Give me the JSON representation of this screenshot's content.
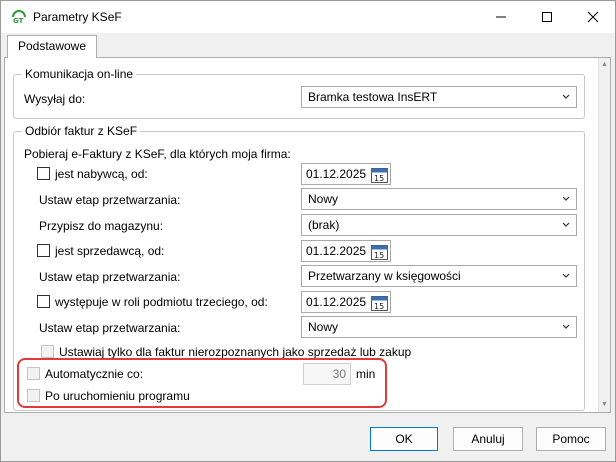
{
  "window": {
    "title": "Parametry KSeF"
  },
  "tabs": [
    {
      "label": "Podstawowe"
    }
  ],
  "communication": {
    "legend": "Komunikacja on-line",
    "send_to_label": "Wysyłaj do:",
    "send_to_value": "Bramka testowa InsERT"
  },
  "receiving": {
    "legend": "Odbiór faktur z KSeF",
    "intro": "Pobieraj e-Faktury z KSeF, dla których moja firma:",
    "buyer_label": "jest nabywcą, od:",
    "buyer_date": "01.12.2025",
    "buyer_stage_label": "Ustaw etap przetwarzania:",
    "buyer_stage_value": "Nowy",
    "warehouse_label": "Przypisz do magazynu:",
    "warehouse_value": "(brak)",
    "seller_label": "jest sprzedawcą, od:",
    "seller_date": "01.12.2025",
    "seller_stage_label": "Ustaw etap przetwarzania:",
    "seller_stage_value": "Przetwarzany w księgowości",
    "third_label": "występuje w roli podmiotu trzeciego, od:",
    "third_date": "01.12.2025",
    "third_stage_label": "Ustaw etap przetwarzania:",
    "third_stage_value": "Nowy",
    "unrecognized_label": "Ustawiaj tylko dla faktur nierozpoznanych jako sprzedaż lub zakup",
    "auto_label": "Automatycznie co:",
    "auto_value": "30",
    "auto_unit": "min",
    "startup_label": "Po uruchomieniu programu",
    "calendar_day": "15"
  },
  "buttons": {
    "ok": "OK",
    "cancel": "Anuluj",
    "help": "Pomoc"
  },
  "colors": {
    "highlight": "#e03a3a",
    "primary_border": "#0078d4"
  }
}
